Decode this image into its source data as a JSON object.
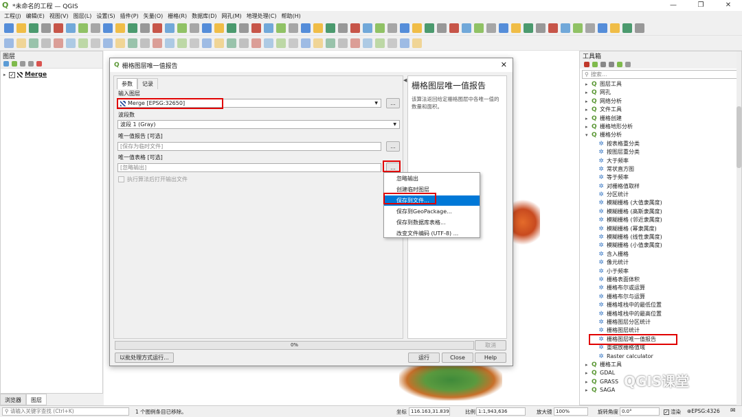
{
  "window": {
    "title": "*未命名的工程 — QGIS",
    "min": "—",
    "max": "❐",
    "close": "✕"
  },
  "menu": [
    "工程(J)",
    "编辑(E)",
    "视图(V)",
    "图层(L)",
    "设置(S)",
    "插件(P)",
    "矢量(O)",
    "栅格(R)",
    "数据库(D)",
    "网孔(M)",
    "地理处理(C)",
    "帮助(H)"
  ],
  "layers_panel": {
    "title": "图层",
    "layer_name": "Merge"
  },
  "left_tabs": [
    "浏览器",
    "图层"
  ],
  "dialog": {
    "title": "栅格图层唯一值报告",
    "tabs": [
      "参数",
      "记录"
    ],
    "input_label": "输入图层",
    "input_value": "Merge [EPSG:32650]",
    "band_label": "波段数",
    "band_value": "波段 1 (Gray)",
    "report_label": "唯一值报告 [可选]",
    "report_placeholder": "[保存为临时文件]",
    "table_label": "唯一值表格 [可选]",
    "table_placeholder": "[忽略输出]",
    "open_after": "执行算法后打开输出文件",
    "help_title": "栅格图层唯一值报告",
    "help_text": "该算法返回给定栅格图层中各唯一值的数量和面积。",
    "progress": "0%",
    "progress_value": 0,
    "cancel": "取消",
    "batch": "以批处理方式运行...",
    "run": "运行",
    "close": "Close",
    "help": "Help",
    "ellipsis": "..."
  },
  "context_menu": [
    "忽略输出",
    "创建临时图层",
    "保存到文件...",
    "保存到GeoPackage...",
    "保存到数据库表格...",
    "改变文件编码 (UTF-8) ..."
  ],
  "toolbox": {
    "title": "工具箱",
    "search_placeholder": "搜索...",
    "groups_top": [
      "图层工具",
      "网孔",
      "网络分析",
      "文件工具",
      "栅格创建",
      "栅格地形分析",
      "栅格分析"
    ],
    "raster_items": [
      "按表格重分类",
      "按图层重分类",
      "大于频率",
      "常状直方图",
      "等于频率",
      "对栅格值取样",
      "分区统计",
      "模糊栅格 (大值隶属度)",
      "模糊栅格 (高斯隶属度)",
      "模糊栅格 (邻近隶属度)",
      "模糊栅格 (幂隶属度)",
      "模糊栅格 (线性隶属度)",
      "模糊栅格 (小值隶属度)",
      "含入栅格",
      "像元统计",
      "小于频率",
      "栅格表面体积",
      "栅格布尔或运算",
      "栅格布尔与运算",
      "栅格堆栈中的最低位置",
      "栅格堆栈中的最高位置",
      "栅格图层分区统计",
      "栅格图层统计",
      "栅格图层唯一值报告",
      "重缩放栅格值域",
      "Raster calculator"
    ],
    "groups_bottom": [
      "栅格工具",
      "GDAL",
      "GRASS",
      "SAGA"
    ]
  },
  "watermark": "QGIS课堂",
  "status": {
    "search_placeholder": "请输入关键字查找 (Ctrl+K)",
    "message": "1 个图例条目已移除。",
    "coord_label": "坐标",
    "coord": "116.163,31.839",
    "scale_label": "比例",
    "scale": "1:1,943,636",
    "magnifier_label": "放大镜",
    "magnifier": "100%",
    "rotation_label": "旋转角度",
    "rotation": "0.0°",
    "render": "渲染",
    "crs": "EPSG:4326"
  }
}
